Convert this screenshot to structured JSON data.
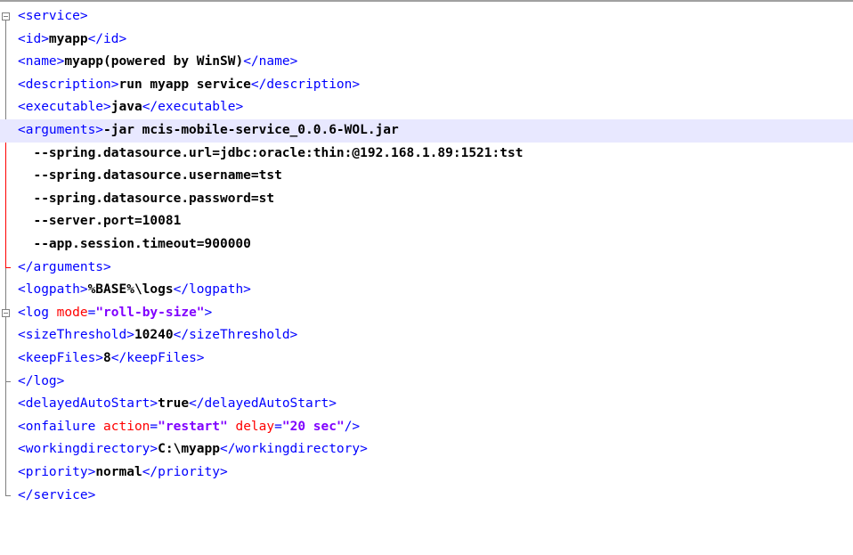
{
  "lines": [
    {
      "tag1": "<service>"
    },
    {
      "tag1": "<id>",
      "text": "myapp",
      "tag2": "</id>"
    },
    {
      "tag1": "<name>",
      "text": "myapp(powered by WinSW)",
      "tag2": "</name>"
    },
    {
      "tag1": "<description>",
      "text": "run myapp service",
      "tag2": "</description>"
    },
    {
      "tag1": "<executable>",
      "text": "java",
      "tag2": "</executable>"
    },
    {
      "tag1": "<arguments>",
      "text": "-jar mcis-mobile-service_0.0.6-WOL.jar"
    },
    {
      "text": "  --spring.datasource.url=jdbc:oracle:thin:@192.168.1.89:1521:tst"
    },
    {
      "text": "  --spring.datasource.username=tst"
    },
    {
      "text": "  --spring.datasource.password=st"
    },
    {
      "text": "  --server.port=10081"
    },
    {
      "text": "  --app.session.timeout=900000"
    },
    {
      "tag1": "</arguments>"
    },
    {
      "tag1": "<logpath>",
      "text": "%BASE%\\logs",
      "tag2": "</logpath>"
    },
    {
      "tag1": "<log ",
      "attr1": "mode",
      "eq1": "=",
      "val1": "\"roll-by-size\"",
      "tag2": ">"
    },
    {
      "tag1": "<sizeThreshold>",
      "text": "10240",
      "tag2": "</sizeThreshold>"
    },
    {
      "tag1": "<keepFiles>",
      "text": "8",
      "tag2": "</keepFiles>"
    },
    {
      "tag1": "</log>"
    },
    {
      "tag1": "<delayedAutoStart>",
      "text": "true",
      "tag2": "</delayedAutoStart>"
    },
    {
      "tag1": "<onfailure ",
      "attr1": "action",
      "eq1": "=",
      "val1": "\"restart\"",
      "sp": " ",
      "attr2": "delay",
      "eq2": "=",
      "val2": "\"20 sec\"",
      "tag2": "/>"
    },
    {
      "tag1": "<workingdirectory>",
      "text": "C:\\myapp",
      "tag2": "</workingdirectory>"
    },
    {
      "tag1": "<priority>",
      "text": "normal",
      "tag2": "</priority>"
    },
    {
      "tag1": "</service>"
    }
  ],
  "colors": {
    "tag": "#0000ff",
    "attr": "#ff0000",
    "value": "#8000ff",
    "current_line": "#e8e8ff",
    "fold_active": "#ff0000"
  },
  "icons": {
    "fold_open": "box-minus-icon",
    "fold_end": "fold-end-icon"
  }
}
